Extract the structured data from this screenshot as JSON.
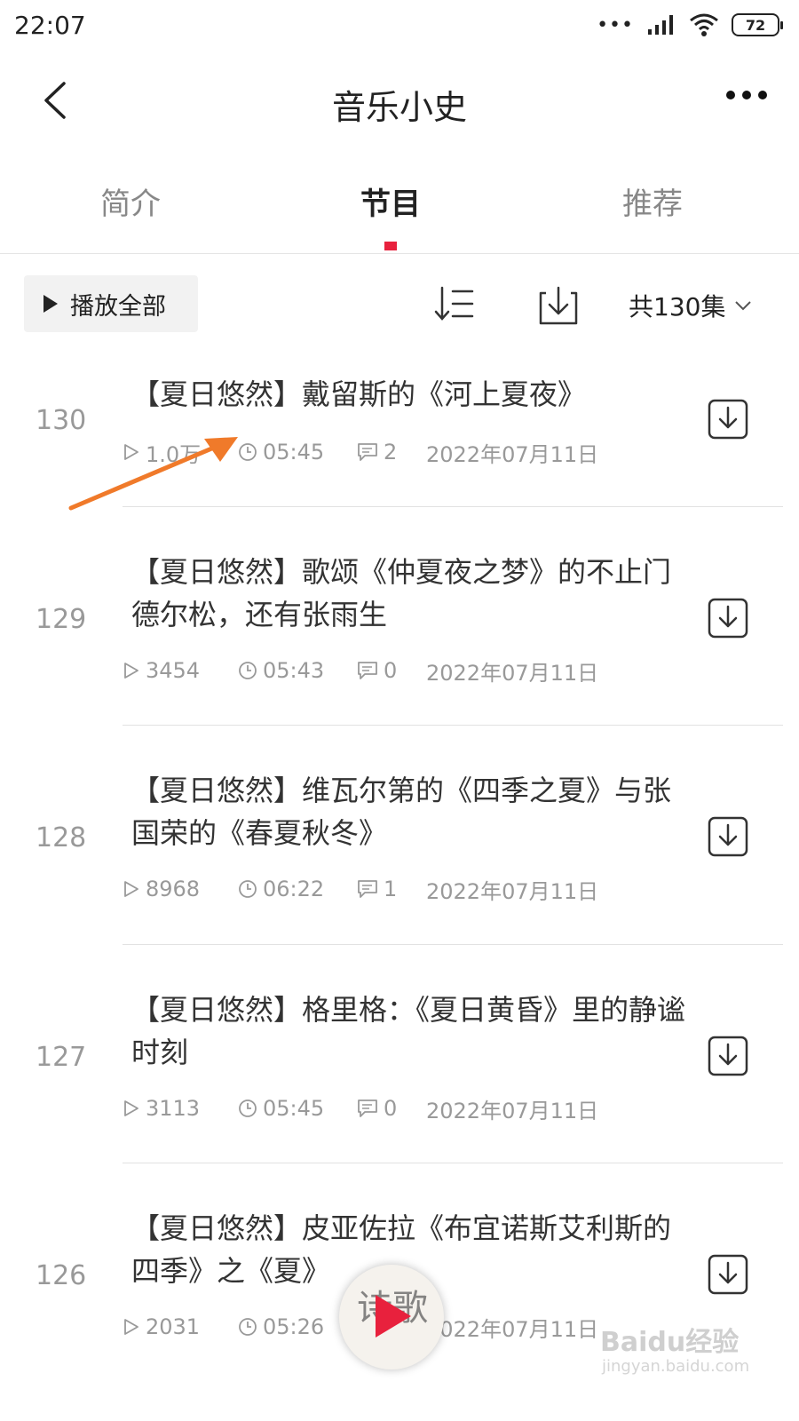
{
  "status_bar": {
    "time": "22:07",
    "battery": "72",
    "icons": [
      "more-dots-icon",
      "signal-icon",
      "wifi-icon",
      "battery-icon"
    ]
  },
  "header": {
    "title": "音乐小史",
    "back_icon": "back-chevron-icon",
    "more_icon": "more-dots-icon"
  },
  "tabs": [
    {
      "label": "简介",
      "active": false
    },
    {
      "label": "节目",
      "active": true
    },
    {
      "label": "推荐",
      "active": false
    }
  ],
  "toolbar": {
    "play_all_label": "播放全部",
    "episode_count": "共130集",
    "sort_icon": "sort-icon",
    "download_icon": "download-icon"
  },
  "episodes": [
    {
      "num": "130",
      "title": "【夏日悠然】戴留斯的《河上夏夜》",
      "plays": "1.0万",
      "duration": "05:45",
      "comments": "2",
      "date": "2022年07月11日"
    },
    {
      "num": "129",
      "title": "【夏日悠然】歌颂《仲夏夜之梦》的不止门德尔松，还有张雨生",
      "plays": "3454",
      "duration": "05:43",
      "comments": "0",
      "date": "2022年07月11日"
    },
    {
      "num": "128",
      "title": "【夏日悠然】维瓦尔第的《四季之夏》与张国荣的《春夏秋冬》",
      "plays": "8968",
      "duration": "06:22",
      "comments": "1",
      "date": "2022年07月11日"
    },
    {
      "num": "127",
      "title": "【夏日悠然】格里格：《夏日黄昏》里的静谧时刻",
      "plays": "3113",
      "duration": "05:45",
      "comments": "0",
      "date": "2022年07月11日"
    },
    {
      "num": "126",
      "title": "【夏日悠然】皮亚佐拉《布宜诺斯艾利斯的四季》之《夏》",
      "plays": "2031",
      "duration": "05:26",
      "comments": "",
      "date": "2022年07月11日"
    }
  ],
  "mini_player": {
    "cover_text": "诗歌"
  },
  "watermark": {
    "text": "Baidu经验",
    "url": "jingyan.baidu.com"
  },
  "colors": {
    "accent": "#e8213d",
    "annotation": "#f07a2a",
    "muted": "#999999"
  }
}
